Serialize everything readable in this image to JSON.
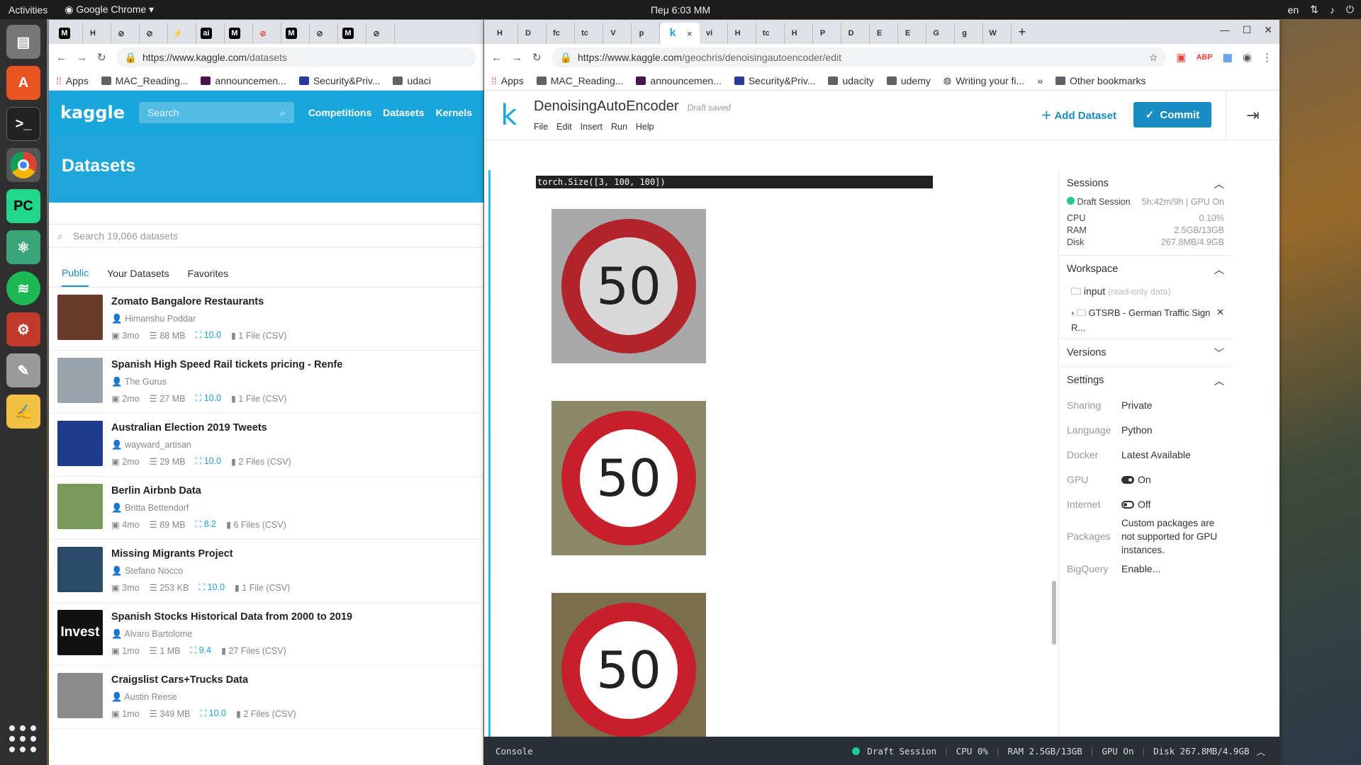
{
  "topbar": {
    "activities": "Activities",
    "app": "Google Chrome",
    "clock": "Пеμ 6:03 MM",
    "lang": "en"
  },
  "left": {
    "tabs": [
      "M",
      "H",
      "⊘",
      "⊘",
      "⚡",
      "ai",
      "M",
      "⊘",
      "M",
      "⊘",
      "M",
      "⊘",
      "⊘"
    ],
    "url_domain": "https://www.kaggle.com",
    "url_path": "/datasets",
    "bookmarks": [
      "Apps",
      "MAC_Reading...",
      "announcemen...",
      "Security&Priv...",
      "udaci"
    ],
    "logo": "kaggle",
    "search_placeholder": "Search",
    "nav": [
      "Competitions",
      "Datasets",
      "Kernels"
    ],
    "hero": "Datasets",
    "ds_search": "Search 19,066 datasets",
    "subtabs": [
      "Public",
      "Your Datasets",
      "Favorites"
    ],
    "datasets": [
      {
        "title": "Zomato Bangalore Restaurants",
        "author": "Himanshu Poddar",
        "age": "3mo",
        "size": "88 MB",
        "score": "10.0",
        "files": "1 File (CSV)",
        "color": "#6a3a2a"
      },
      {
        "title": "Spanish High Speed Rail tickets pricing - Renfe",
        "author": "The Gurus",
        "age": "2mo",
        "size": "27 MB",
        "score": "10.0",
        "files": "1 File (CSV)",
        "color": "#9aa4ad"
      },
      {
        "title": "Australian Election 2019 Tweets",
        "author": "wayward_artisan",
        "age": "2mo",
        "size": "29 MB",
        "score": "10.0",
        "files": "2 Files (CSV)",
        "color": "#1d3b8a"
      },
      {
        "title": "Berlin Airbnb Data",
        "author": "Britta Bettendorf",
        "age": "4mo",
        "size": "89 MB",
        "score": "8.2",
        "files": "6 Files (CSV)",
        "color": "#7a9a5a"
      },
      {
        "title": "Missing Migrants Project",
        "author": "Stefano Nocco",
        "age": "3mo",
        "size": "253 KB",
        "score": "10.0",
        "files": "1 File (CSV)",
        "color": "#2a4a6a"
      },
      {
        "title": "Spanish Stocks Historical Data from 2000 to 2019",
        "author": "Alvaro Bartolome",
        "age": "1mo",
        "size": "1 MB",
        "score": "9.4",
        "files": "27 Files (CSV)",
        "color": "#111"
      },
      {
        "title": "Craigslist Cars+Trucks Data",
        "author": "Austin Reese",
        "age": "1mo",
        "size": "349 MB",
        "score": "10.0",
        "files": "2 Files (CSV)",
        "color": "#8a8a8a"
      }
    ],
    "invest_text": "Invest"
  },
  "right": {
    "tabs": [
      "H",
      "D",
      "fc",
      "tc",
      "V",
      "p",
      "k",
      "vi",
      "H",
      "tc",
      "H",
      "P",
      "D",
      "E",
      "E",
      "G",
      "g",
      "W"
    ],
    "url_domain": "https://www.kaggle.com",
    "url_path": "/geochris/denoisingautoencoder/edit",
    "bookmarks": [
      "Apps",
      "MAC_Reading...",
      "announcemen...",
      "Security&Priv...",
      "udacity",
      "udemy",
      "Writing your fi...",
      "Other bookmarks"
    ],
    "k": "k",
    "title": "DenoisingAutoEncoder",
    "saved": "Draft saved",
    "menu": [
      "File",
      "Edit",
      "Insert",
      "Run",
      "Help"
    ],
    "add_dataset": "Add Dataset",
    "commit": "Commit",
    "output": "torch.Size([3, 100, 100])",
    "sign_text": "50",
    "sessions": {
      "head": "Sessions",
      "name": "Draft Session",
      "time": "5h:42m/9h",
      "gpu": "GPU On",
      "cpu_l": "CPU",
      "cpu": "0.10%",
      "ram_l": "RAM",
      "ram": "2.5GB/13GB",
      "disk_l": "Disk",
      "disk": "267.8MB/4.9GB"
    },
    "workspace": {
      "head": "Workspace",
      "input": "input",
      "ro": "(read-only data)",
      "ds": "GTSRB - German Traffic Sign R..."
    },
    "versions": "Versions",
    "settings": {
      "head": "Settings",
      "sharing_l": "Sharing",
      "sharing": "Private",
      "lang_l": "Language",
      "lang": "Python",
      "docker_l": "Docker",
      "docker": "Latest Available",
      "gpu_l": "GPU",
      "gpu": "On",
      "net_l": "Internet",
      "net": "Off",
      "pkg_l": "Packages",
      "pkg": "Custom packages are not supported for GPU instances.",
      "bq_l": "BigQuery",
      "bq": "Enable..."
    },
    "console": {
      "label": "Console",
      "session": "Draft Session",
      "cpu": "CPU 0%",
      "ram": "RAM 2.5GB/13GB",
      "gpu": "GPU On",
      "disk": "Disk 267.8MB/4.9GB"
    }
  }
}
